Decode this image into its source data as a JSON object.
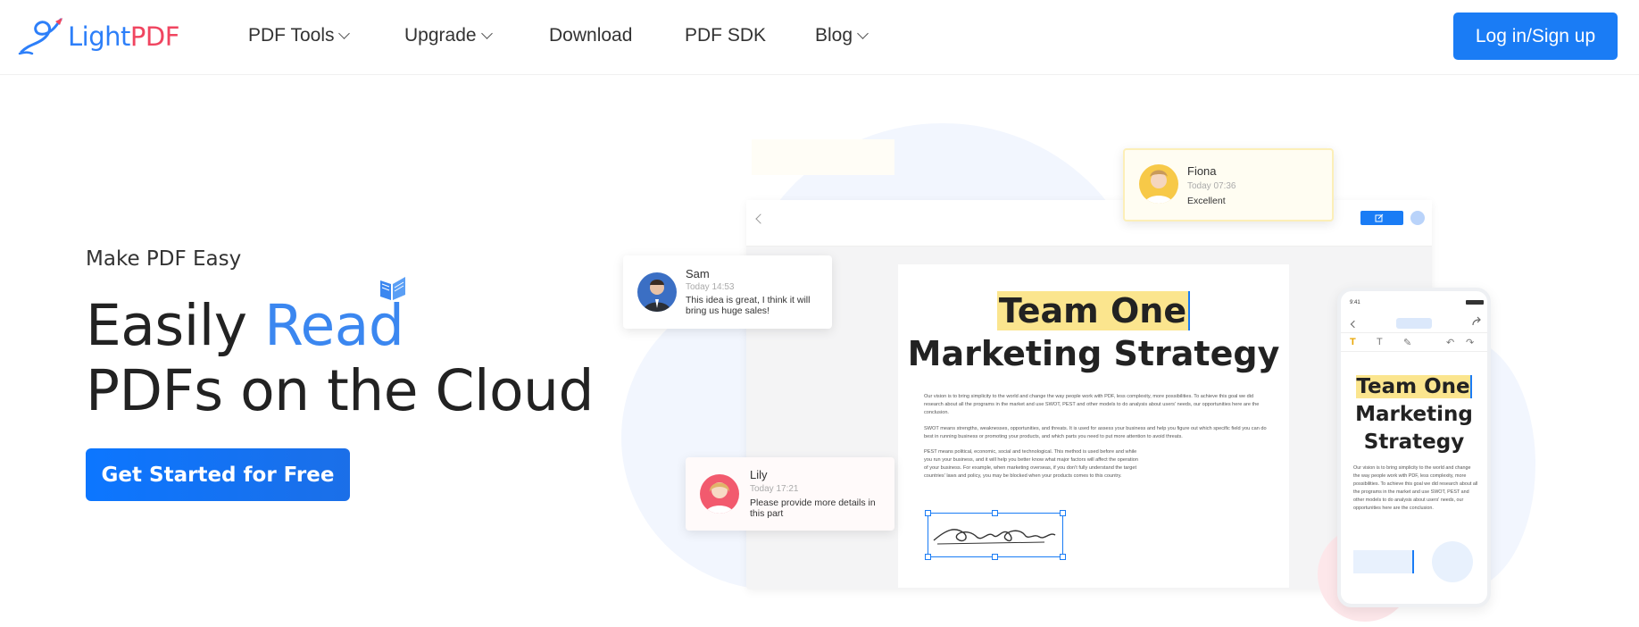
{
  "brand": {
    "light": "Light",
    "pdf": "PDF",
    "colors": {
      "primary": "#1a7cf5",
      "accent": "#f04560",
      "highlight": "#fbe58e"
    }
  },
  "nav": {
    "items": [
      {
        "label": "PDF Tools",
        "has_dropdown": true
      },
      {
        "label": "Upgrade",
        "has_dropdown": true
      },
      {
        "label": "Download",
        "has_dropdown": false
      },
      {
        "label": "PDF SDK",
        "has_dropdown": false
      },
      {
        "label": "Blog",
        "has_dropdown": true
      }
    ],
    "login_label": "Log in/Sign up"
  },
  "hero": {
    "eyebrow": "Make PDF Easy",
    "title_pre": "Easily ",
    "title_accent": "Read",
    "title_line2": "PDFs on the Cloud",
    "cta_label": "Get Started for Free"
  },
  "document": {
    "title_highlight": "Team One",
    "title_line2": "Marketing Strategy",
    "paragraphs": [
      "Our vision is to bring simplicity to the world and change the way people work with PDF, less complexity, more possibilities. To achieve this goal we did research about all the programs in the market and use SWOT, PEST and other models to do analysis about users' needs, our opportunities here are the conclusion.",
      "SWOT means strengths, weaknesses, opportunities, and threats. It is used for assess your business and help you figure out which specific field you can do best in running business or promoting your products, and which parts you need to put more attention to avoid threats.",
      "PEST means political, economic, social and technological. This method is used before and while you run your business, and it will help you better know what major factors will affect the operation of your business. For example, when marketing overseas, if you don't fully understand the target countries' laws and policy, you may be blocked when your products comes to this country."
    ]
  },
  "phone": {
    "time": "9:41",
    "title_highlight": "Team One",
    "title_line2": "Marketing",
    "title_line3": "Strategy",
    "paragraph": "Our vision is to bring simplicity to the world and change the way people work with PDF, less complexity, more possibilities. To achieve this goal we did research about all the programs in the market and use SWOT, PEST and other models to do analysis about users' needs, our opportunities here are the conclusion."
  },
  "comments": [
    {
      "name": "Fiona",
      "time": "Today 07:36",
      "message": "Excellent"
    },
    {
      "name": "Sam",
      "time": "Today 14:53",
      "message": "This idea is great, I think it will bring us huge sales!"
    },
    {
      "name": "Lily",
      "time": "Today 17:21",
      "message": "Please provide more details in this part"
    }
  ]
}
